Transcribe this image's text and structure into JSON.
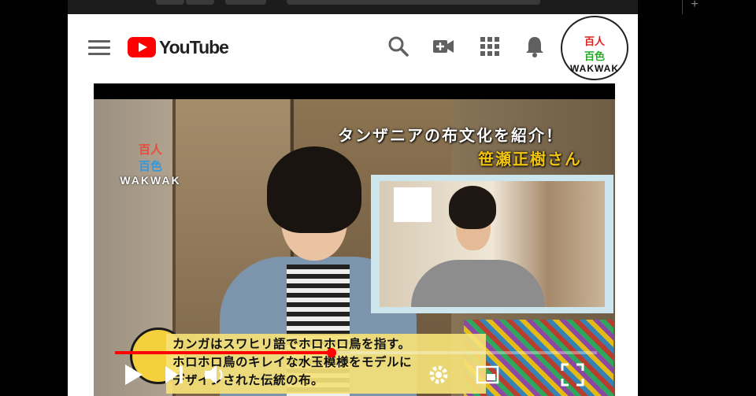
{
  "browser": {
    "new_tab_symbol": "+"
  },
  "header": {
    "menu_icon": "hamburger-menu-icon",
    "logo_text": "YouTube",
    "icons": [
      "search-icon",
      "video-camera-add-icon",
      "apps-grid-icon",
      "bell-icon"
    ],
    "avatar": {
      "line1": "百人",
      "line2": "百色",
      "line3": "WAKWAK"
    }
  },
  "video": {
    "title_line1": "タンザニアの布文化を紹介！",
    "title_line2": "笹瀬正樹さん",
    "watermark": {
      "line1": "百人",
      "line2": "百色",
      "line3": "WAKWAK"
    },
    "caption_lines": [
      "カンガはスワヒリ語でホロホロ鳥を指す。",
      "ホロホロ鳥のキレイな水玉模様をモデルに",
      "デザインされた伝統の布。"
    ],
    "progress_fraction": 0.45,
    "controls": [
      "play-icon",
      "next-icon",
      "volume-icon",
      "settings-gear-icon",
      "miniplayer-icon",
      "fullscreen-icon"
    ],
    "colors": {
      "progress": "#ff0000",
      "caption_bg": "#f5e178",
      "title_highlight": "#f1c40f"
    }
  }
}
